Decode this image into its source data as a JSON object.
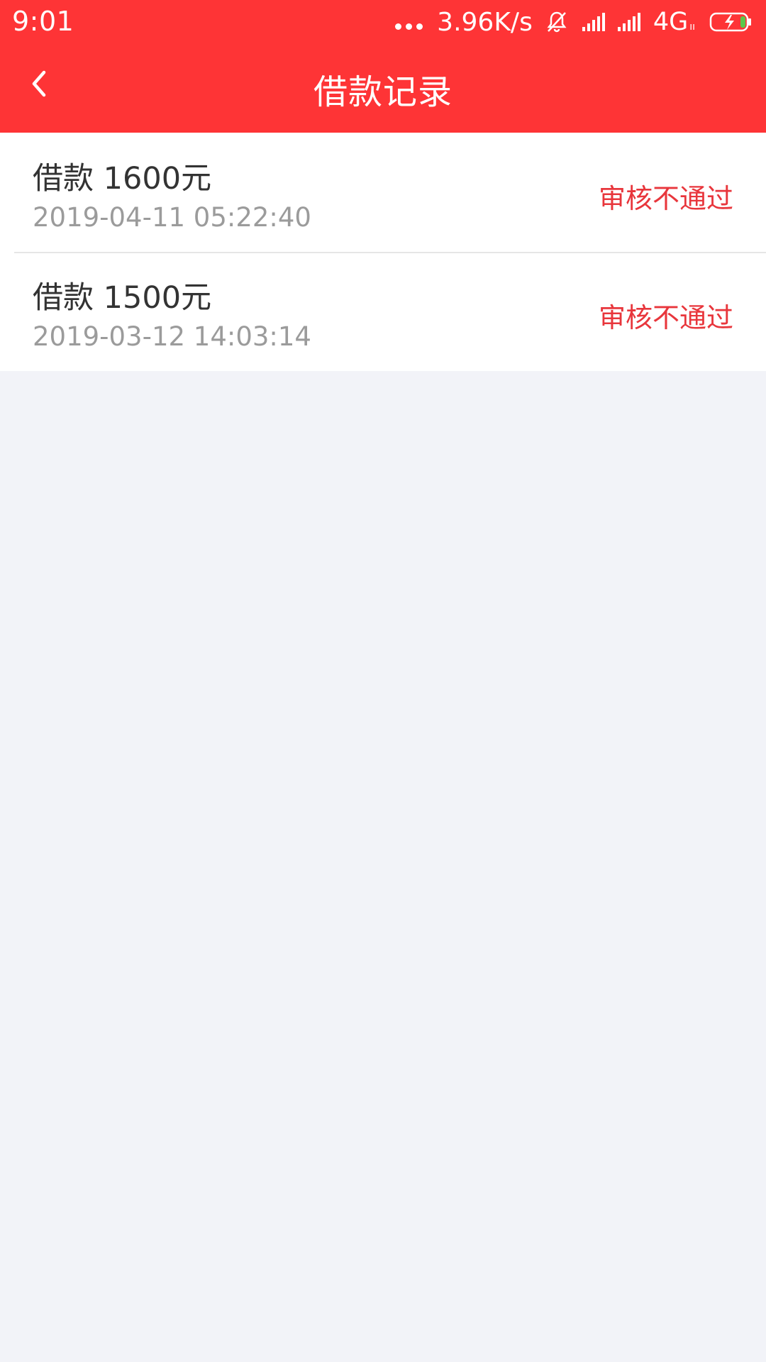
{
  "status_bar": {
    "time": "9:01",
    "speed": "3.96K/s",
    "network": "4G",
    "network_sub": "ıı"
  },
  "header": {
    "title": "借款记录",
    "back_icon": "chevron-left-icon"
  },
  "records": [
    {
      "amount": "借款 1600元",
      "time": "2019-04-11 05:22:40",
      "status": "审核不通过"
    },
    {
      "amount": "借款 1500元",
      "time": "2019-03-12 14:03:14",
      "status": "审核不通过"
    }
  ],
  "colors": {
    "header_bg": "#fe3436",
    "status_text": "#e8363c",
    "page_bg": "#f2f3f8"
  }
}
